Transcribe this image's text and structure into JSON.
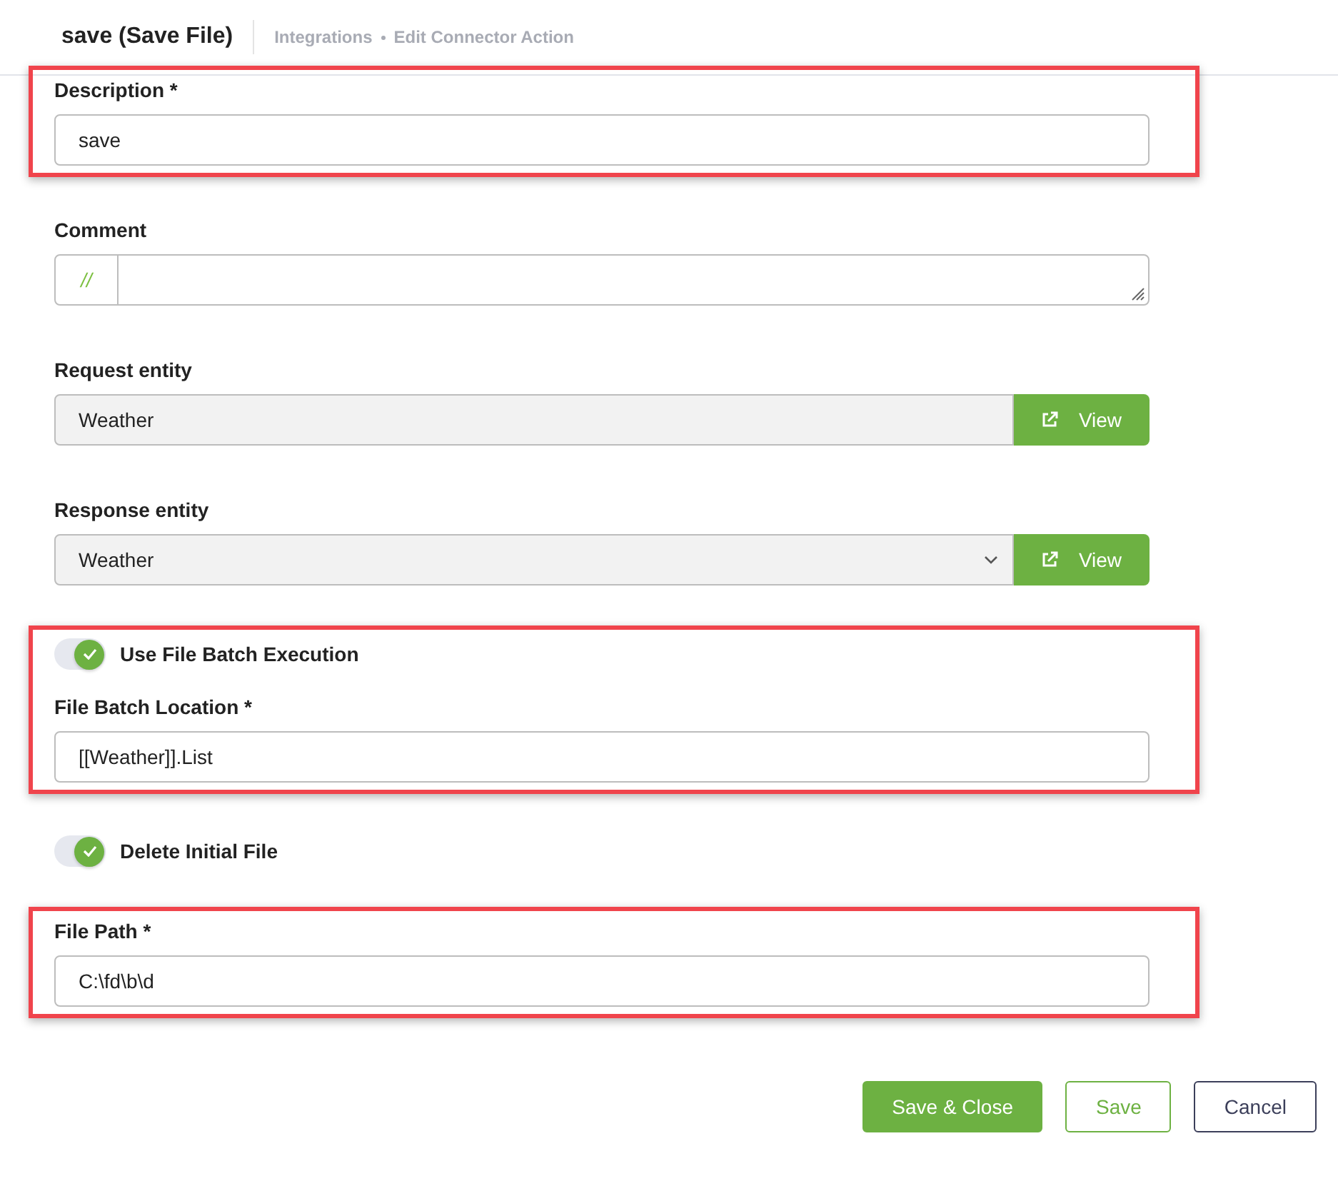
{
  "header": {
    "title": "save (Save File)",
    "breadcrumb": [
      "Integrations",
      "Edit Connector Action"
    ]
  },
  "sections": [
    {
      "highlighted": true,
      "fields": [
        {
          "kind": "text",
          "label": "Description *",
          "value": "save"
        }
      ]
    },
    {
      "highlighted": false,
      "fields": [
        {
          "kind": "comment",
          "label": "Comment",
          "prefix": "//"
        }
      ]
    },
    {
      "highlighted": false,
      "fields": [
        {
          "kind": "readonly_view",
          "label": "Request entity",
          "value": "Weather",
          "button": "View"
        }
      ]
    },
    {
      "highlighted": false,
      "fields": [
        {
          "kind": "select_view",
          "label": "Response entity",
          "value": "Weather",
          "button": "View"
        }
      ]
    },
    {
      "highlighted": true,
      "fields": [
        {
          "kind": "toggle",
          "label": "Use File Batch Execution",
          "on": true
        },
        {
          "kind": "text",
          "label": "File Batch Location *",
          "value": "[[Weather]].List"
        }
      ]
    },
    {
      "highlighted": false,
      "fields": [
        {
          "kind": "toggle",
          "label": "Delete Initial File",
          "on": true
        }
      ]
    },
    {
      "highlighted": true,
      "fields": [
        {
          "kind": "text",
          "label": "File Path *",
          "value": "C:\\fd\\b\\d"
        }
      ]
    }
  ],
  "buttons": [
    {
      "kind": "primary",
      "label": "Save & Close"
    },
    {
      "kind": "outline",
      "label": "Save"
    },
    {
      "kind": "secondary",
      "label": "Cancel"
    }
  ]
}
